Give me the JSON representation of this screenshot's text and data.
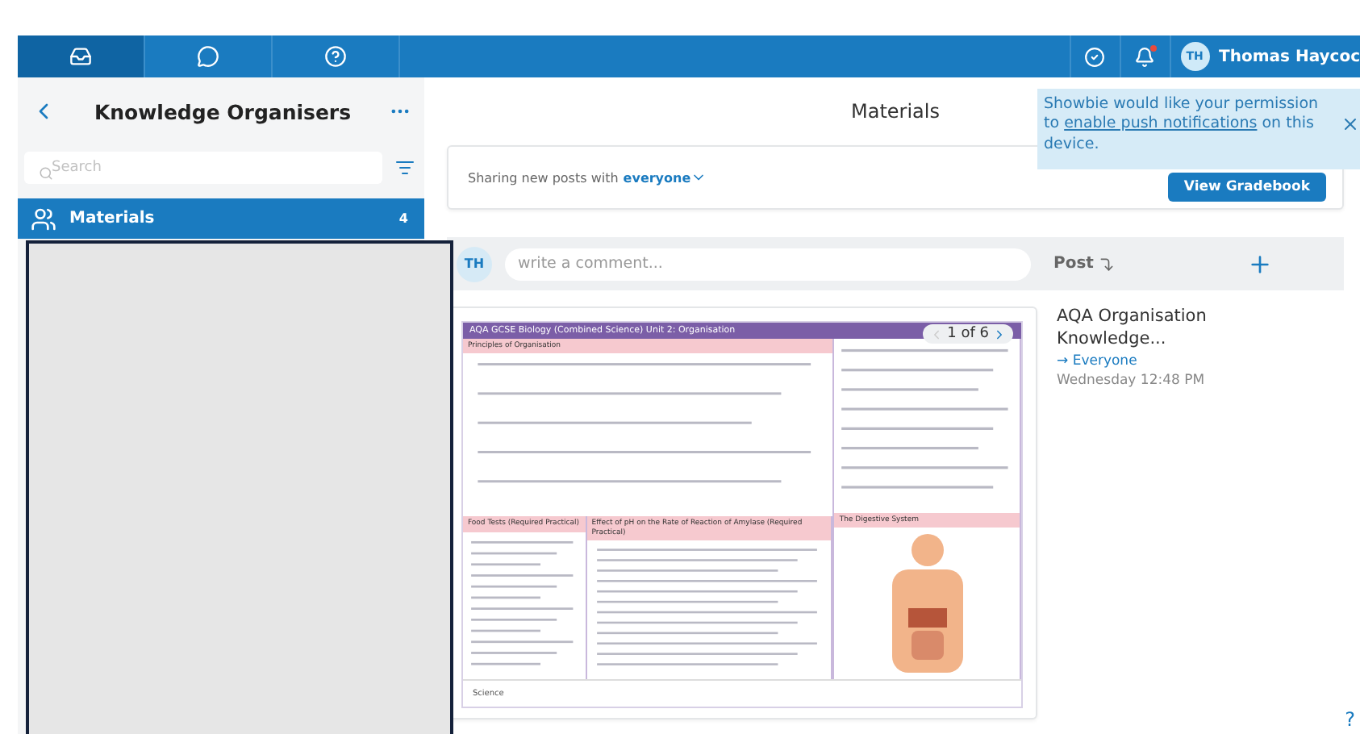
{
  "top_bar": {
    "tabs": [
      {
        "selected": true
      },
      {
        "selected": false
      },
      {
        "selected": false
      }
    ],
    "notification_dot": true,
    "user": {
      "initials": "TH",
      "name": "Thomas Haycoc"
    }
  },
  "sidebar": {
    "title": "Knowledge Organisers",
    "search": {
      "placeholder": "Search"
    },
    "items": [
      {
        "label": "Materials",
        "count": "4",
        "selected": true
      }
    ]
  },
  "redacted": true,
  "main": {
    "title": "Materials",
    "sharing": {
      "text": "Sharing new posts with",
      "audience": "everyone"
    },
    "gradebook_button": "View Gradebook",
    "composer": {
      "initials": "TH",
      "placeholder": "write a comment...",
      "post": "Post"
    },
    "post": {
      "document": {
        "heading": "AQA GCSE Biology (Combined Science) Unit 2: Organisation",
        "sections": [
          "Principles of Organisation",
          "Food Tests (Required Practical)",
          "Effect of pH on the Rate of Reaction of Amylase (Required Practical)",
          "The Digestive System"
        ],
        "footer": "Science",
        "pager": "1 of 6"
      },
      "title": "AQA Organisation Knowledge...",
      "audience": "→ Everyone",
      "time": "Wednesday 12:48 PM"
    }
  },
  "toast": {
    "before": "Showbie would like your permission to",
    "link": "enable push notifications",
    "after": "on this device."
  },
  "help": "?"
}
